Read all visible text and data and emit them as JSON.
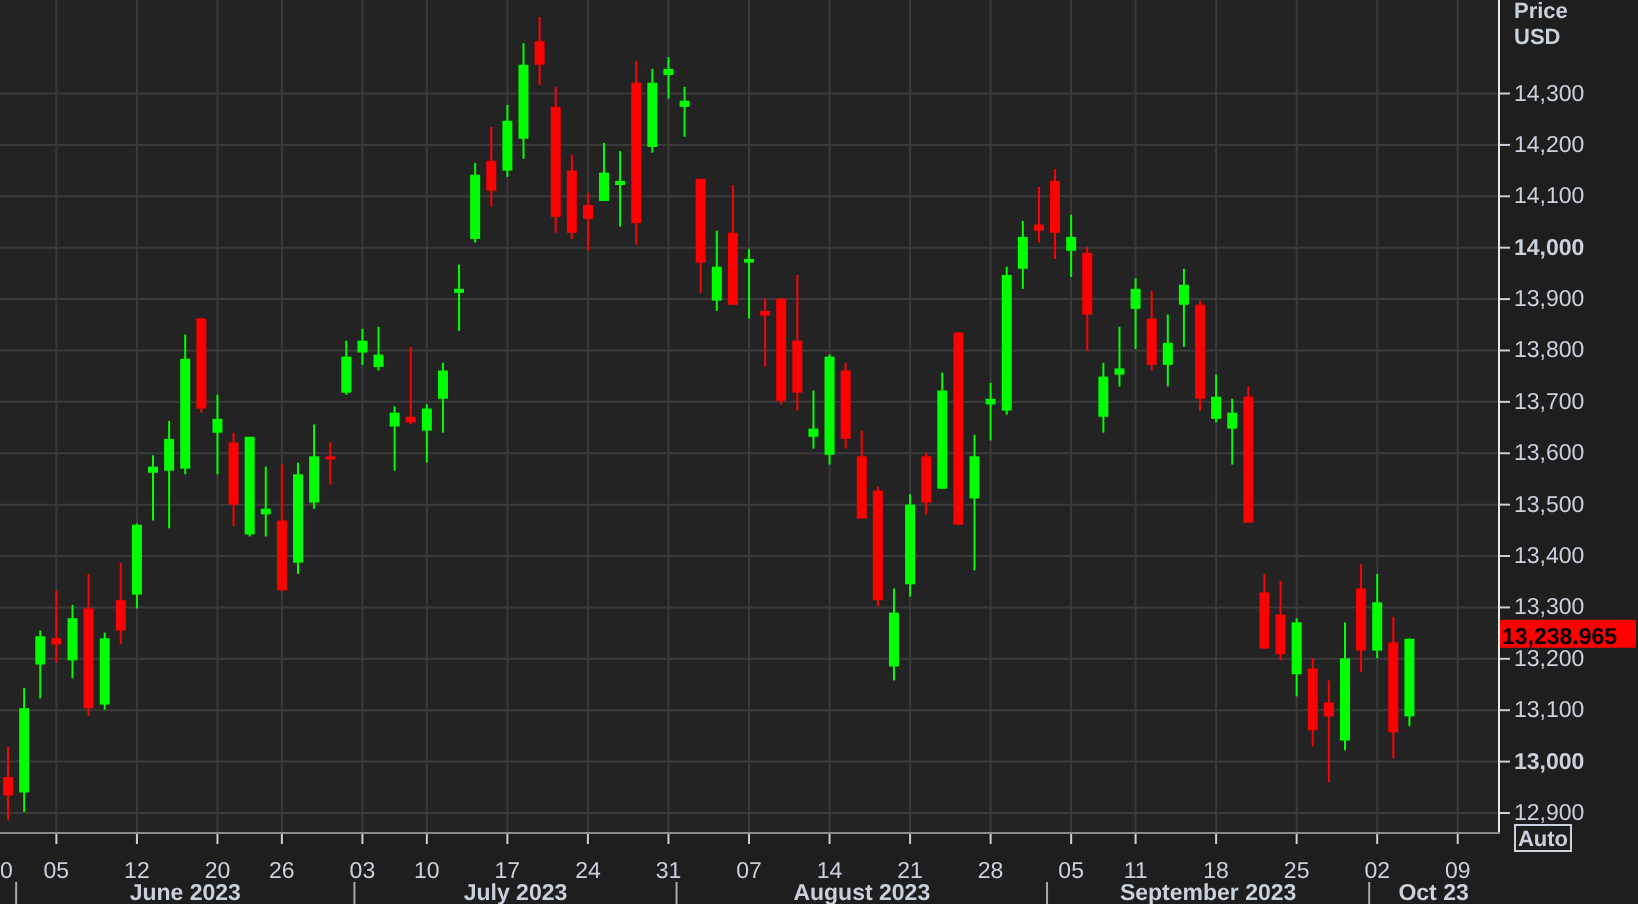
{
  "chart": {
    "chart_data": {
      "type": "candlestick",
      "ylabel": "Price USD",
      "grid": true,
      "ylim": [
        12863,
        14482
      ],
      "categories": [
        null,
        null,
        null,
        "05",
        null,
        null,
        null,
        null,
        "12",
        null,
        null,
        null,
        null,
        "20",
        null,
        null,
        null,
        "26",
        null,
        null,
        null,
        null,
        "03",
        null,
        null,
        null,
        "10",
        null,
        null,
        null,
        null,
        "17",
        null,
        null,
        null,
        null,
        "24",
        null,
        null,
        null,
        null,
        "31",
        null,
        null,
        null,
        null,
        "07",
        null,
        null,
        null,
        null,
        "14",
        null,
        null,
        null,
        null,
        "21",
        null,
        null,
        null,
        null,
        "28",
        null,
        null,
        null,
        null,
        "05",
        null,
        null,
        null,
        "11",
        null,
        null,
        null,
        null,
        "18",
        null,
        null,
        null,
        null,
        "25",
        null,
        null,
        null,
        null,
        "02",
        null,
        null,
        null,
        null,
        "09",
        null,
        null
      ],
      "ohlc": [
        [
          12970,
          13029,
          12886,
          12934
        ],
        [
          12940,
          13143,
          12902,
          13104
        ],
        [
          13189,
          13255,
          13123,
          13244
        ],
        [
          13240,
          13333,
          13193,
          13228
        ],
        [
          13197,
          13305,
          13162,
          13279
        ],
        [
          13298,
          13365,
          13089,
          13104
        ],
        [
          13111,
          13251,
          13101,
          13240
        ],
        [
          13314,
          13387,
          13228,
          13255
        ],
        [
          13325,
          13463,
          13298,
          13461
        ],
        [
          13562,
          13596,
          13469,
          13574
        ],
        [
          13566,
          13663,
          13454,
          13628
        ],
        [
          13570,
          13831,
          13559,
          13784
        ],
        [
          13862,
          13864,
          13679,
          13687
        ],
        [
          13640,
          13714,
          13559,
          13667
        ],
        [
          13621,
          13640,
          13458,
          13500
        ],
        [
          13442,
          13632,
          13438,
          13632
        ],
        [
          13481,
          13574,
          13438,
          13492
        ],
        [
          13469,
          13578,
          13333,
          13333
        ],
        [
          13387,
          13582,
          13365,
          13559
        ],
        [
          13504,
          13656,
          13492,
          13594
        ],
        [
          13594,
          13621,
          13539,
          13588
        ],
        [
          13718,
          13819,
          13714,
          13788
        ],
        [
          13796,
          13842,
          13772,
          13819
        ],
        [
          13768,
          13846,
          13761,
          13792
        ],
        [
          13652,
          13691,
          13566,
          13679
        ],
        [
          13671,
          13807,
          13656,
          13660
        ],
        [
          13644,
          13695,
          13582,
          13687
        ],
        [
          13706,
          13776,
          13640,
          13761
        ],
        [
          13912,
          13967,
          13838,
          13920
        ],
        [
          14017,
          14165,
          14010,
          14142
        ],
        [
          14169,
          14235,
          14080,
          14111
        ],
        [
          14150,
          14278,
          14138,
          14247
        ],
        [
          14212,
          14398,
          14173,
          14356
        ],
        [
          14402,
          14449,
          14317,
          14356
        ],
        [
          14274,
          14313,
          14029,
          14060
        ],
        [
          14150,
          14181,
          14017,
          14029
        ],
        [
          14083,
          14107,
          13994,
          14056
        ],
        [
          14091,
          14204,
          14091,
          14146
        ],
        [
          14122,
          14188,
          14041,
          14130
        ],
        [
          14321,
          14363,
          14006,
          14048
        ],
        [
          14196,
          14348,
          14185,
          14321
        ],
        [
          14336,
          14371,
          14290,
          14348
        ],
        [
          14274,
          14313,
          14216,
          14286
        ],
        [
          14134,
          14134,
          13912,
          13971
        ],
        [
          13897,
          14033,
          13877,
          13963
        ],
        [
          14029,
          14122,
          13889,
          13889
        ],
        [
          13971,
          13998,
          13862,
          13978
        ],
        [
          13877,
          13901,
          13768,
          13868
        ],
        [
          13901,
          13901,
          13695,
          13702
        ],
        [
          13819,
          13947,
          13683,
          13718
        ],
        [
          13632,
          13722,
          13609,
          13648
        ],
        [
          13597,
          13792,
          13578,
          13788
        ],
        [
          13761,
          13776,
          13609,
          13628
        ],
        [
          13594,
          13644,
          13473,
          13473
        ],
        [
          13527,
          13535,
          13302,
          13314
        ],
        [
          13185,
          13337,
          13158,
          13290
        ],
        [
          13345,
          13520,
          13321,
          13500
        ],
        [
          13594,
          13601,
          13481,
          13504
        ],
        [
          13531,
          13757,
          13531,
          13722
        ],
        [
          13835,
          13835,
          13461,
          13461
        ],
        [
          13512,
          13636,
          13372,
          13594
        ],
        [
          13695,
          13737,
          13625,
          13706
        ],
        [
          13683,
          13963,
          13675,
          13947
        ],
        [
          13959,
          14052,
          13920,
          14021
        ],
        [
          14045,
          14118,
          14010,
          14033
        ],
        [
          14130,
          14153,
          13978,
          14029
        ],
        [
          13994,
          14064,
          13943,
          14021
        ],
        [
          13990,
          14002,
          13800,
          13870
        ],
        [
          13671,
          13776,
          13640,
          13749
        ],
        [
          13753,
          13846,
          13730,
          13765
        ],
        [
          13881,
          13940,
          13803,
          13920
        ],
        [
          13862,
          13916,
          13761,
          13772
        ],
        [
          13772,
          13870,
          13730,
          13815
        ],
        [
          13889,
          13959,
          13807,
          13928
        ],
        [
          13889,
          13897,
          13683,
          13706
        ],
        [
          13667,
          13753,
          13660,
          13710
        ],
        [
          13648,
          13706,
          13578,
          13679
        ],
        [
          13710,
          13730,
          13465,
          13465
        ],
        [
          13329,
          13365,
          13220,
          13220
        ],
        [
          13286,
          13352,
          13197,
          13209
        ],
        [
          13170,
          13279,
          13127,
          13271
        ],
        [
          13181,
          13201,
          13030,
          13061
        ],
        [
          13115,
          13158,
          12960,
          13088
        ],
        [
          13041,
          13271,
          13022,
          13201
        ],
        [
          13337,
          13384,
          13174,
          13216
        ],
        [
          13216,
          13365,
          13201,
          13310
        ],
        [
          13232,
          13282,
          13006,
          13057
        ],
        [
          13088,
          13240,
          13069,
          13239
        ],
        null,
        null,
        null,
        null,
        null
      ],
      "yticks": [
        {
          "value": 12900,
          "label": "12,900"
        },
        {
          "value": 13000,
          "label": "13,000"
        },
        {
          "value": 13100,
          "label": "13,100"
        },
        {
          "value": 13200,
          "label": "13,200"
        },
        {
          "value": 13300,
          "label": "13,300"
        },
        {
          "value": 13400,
          "label": "13,400"
        },
        {
          "value": 13500,
          "label": "13,500"
        },
        {
          "value": 13600,
          "label": "13,600"
        },
        {
          "value": 13700,
          "label": "13,700"
        },
        {
          "value": 13800,
          "label": "13,800"
        },
        {
          "value": 13900,
          "label": "13,900"
        },
        {
          "value": 14000,
          "label": "14,000"
        },
        {
          "value": 14100,
          "label": "14,100"
        },
        {
          "value": 14200,
          "label": "14,200"
        },
        {
          "value": 14300,
          "label": "14,300"
        }
      ],
      "annotations": [
        "13,238.965"
      ]
    },
    "edge_tick_label": "0",
    "month_labels": [
      "June 2023",
      "July 2023",
      "August 2023",
      "September 2023",
      "Oct 23"
    ],
    "auto_button": {
      "label": "Auto"
    }
  }
}
